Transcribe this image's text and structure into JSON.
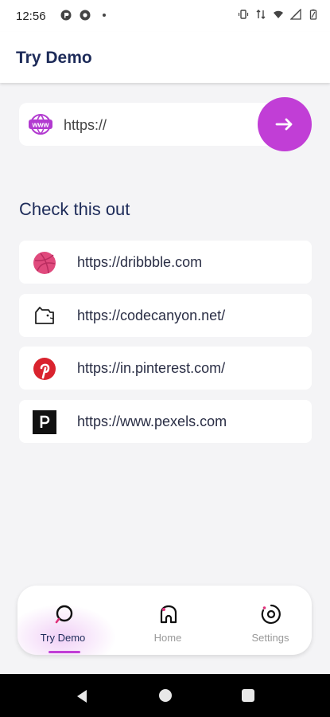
{
  "status_bar": {
    "time": "12:56"
  },
  "app_bar": {
    "title": "Try Demo"
  },
  "url_input": {
    "placeholder": "https://",
    "value": ""
  },
  "section": {
    "title": "Check this out"
  },
  "sites": [
    {
      "url": "https://dribbble.com",
      "icon": "dribbble-icon"
    },
    {
      "url": "https://codecanyon.net/",
      "icon": "codecanyon-icon"
    },
    {
      "url": "https://in.pinterest.com/",
      "icon": "pinterest-icon"
    },
    {
      "url": "https://www.pexels.com",
      "icon": "pexels-icon"
    }
  ],
  "bottom_nav": {
    "items": [
      {
        "label": "Try Demo",
        "icon": "search-icon",
        "active": true
      },
      {
        "label": "Home",
        "icon": "home-icon",
        "active": false
      },
      {
        "label": "Settings",
        "icon": "settings-icon",
        "active": false
      }
    ]
  },
  "colors": {
    "accent": "#c13ed6",
    "title": "#1d2b59",
    "background": "#f4f4f6"
  }
}
